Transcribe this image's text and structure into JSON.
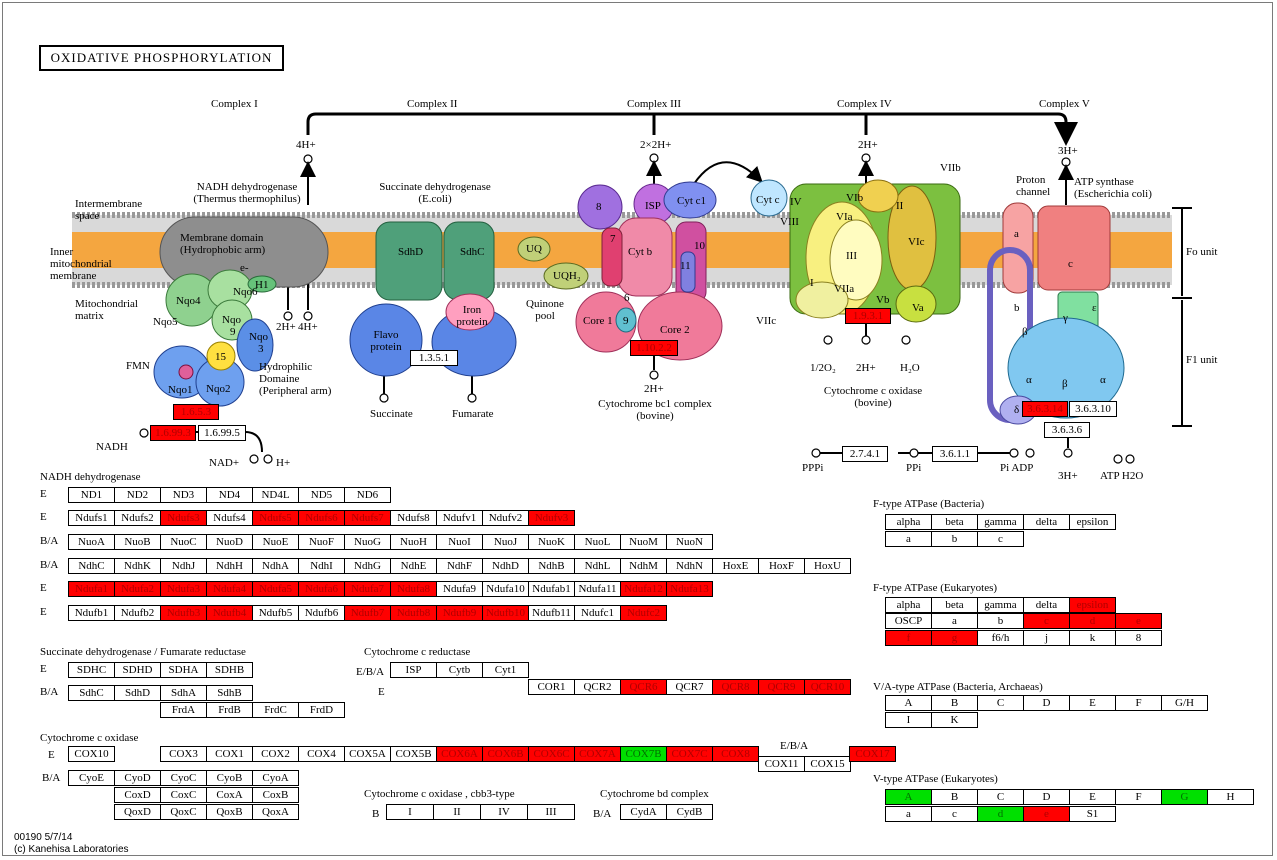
{
  "title": "OXIDATIVE PHOSPHORYLATION",
  "footer": {
    "line1": "00190 5/7/14",
    "line2": "(c) Kanehisa Laboratories"
  },
  "colors": {
    "red": "#ff0000",
    "green": "#00e000",
    "membrane": "#f4a640"
  },
  "diagram": {
    "complexes": [
      "Complex I",
      "Complex II",
      "Complex III",
      "Complex IV",
      "Complex V"
    ],
    "labels": {
      "intermembrane": "Intermembrane space",
      "inner_membrane": "Inner mitochondrial membrane",
      "matrix": "Mitochondrial matrix",
      "nadh_dh": "NADH dehydrogenase (Thermus thermophilus)",
      "membrane_domain": "Membrane domain (Hydrophobic arm)",
      "hydrophilic": "Hydrophilic Domaine (Peripheral arm)",
      "succ_dh": "Succinate dehydrogenase (E.coli)",
      "quinone_pool": "Quinone pool",
      "cyt_bc1": "Cytochrome bc1 complex (bovine)",
      "cyt_c_ox": "Cytochrome c oxidase (bovine)",
      "proton_channel": "Proton channel",
      "atp_synthase": "ATP synthase (Escherichia coli)",
      "fo_unit": "Fo unit",
      "f1_unit": "F1 unit"
    },
    "subunits_c1": [
      "Nqo6",
      "Nqo4",
      "Nqo5",
      "Nqo",
      "9",
      "Nqo",
      "3",
      "15",
      "Nqo1",
      "Nqo2",
      "FMN",
      "H1"
    ],
    "subunits_c2": [
      "SdhD",
      "SdhC",
      "Flavo protein",
      "Iron protein"
    ],
    "subunits_c3": [
      "8",
      "ISP",
      "Cyt c1",
      "7",
      "Cyt b",
      "10",
      "11",
      "6",
      "Core 1",
      "9",
      "Core 2"
    ],
    "subunits_c4": [
      "Cyt c",
      "IV",
      "VIII",
      "VIb",
      "VIa",
      "III",
      "II",
      "VIc",
      "I",
      "VIIa",
      "Vb",
      "Va",
      "VIIb",
      "VIIc"
    ],
    "subunits_c5": [
      "a",
      "c",
      "b",
      "γ",
      "ε",
      "β",
      "α",
      "β",
      "α",
      "δ"
    ],
    "metabolites": {
      "h4_a": "4H+",
      "h4_b": "4H+",
      "h2_a": "2H+",
      "h2x2": "2×2H+",
      "h2_c": "2H+",
      "h3": "3H+",
      "e": "e-",
      "uq": "UQ",
      "uqh2": "UQH₂",
      "succinate": "Succinate",
      "fumarate": "Fumarate",
      "nadh": "NADH",
      "nad": "NAD+",
      "h_nad": "H+",
      "h2_c3": "2H+",
      "o2": "1/2O₂",
      "h2_c4": "2H+",
      "h2o": "H₂O",
      "pppi": "PPPi",
      "ppi": "PPi",
      "pi_adp": "Pi ADP",
      "h3_c5": "3H+",
      "atp_h2o": "ATP H2O"
    },
    "ec_boxes": [
      {
        "label": "1.6.5.3",
        "state": "red"
      },
      {
        "label": "1.6.99.3",
        "state": "red"
      },
      {
        "label": "1.6.99.5",
        "state": "none"
      },
      {
        "label": "1.3.5.1",
        "state": "none"
      },
      {
        "label": "1.10.2.2",
        "state": "red"
      },
      {
        "label": "1.9.3.1",
        "state": "red"
      },
      {
        "label": "3.6.3.14",
        "state": "red"
      },
      {
        "label": "3.6.3.10",
        "state": "none"
      },
      {
        "label": "3.6.3.6",
        "state": "none"
      },
      {
        "label": "2.7.4.1",
        "state": "none"
      },
      {
        "label": "3.6.1.1",
        "state": "none"
      }
    ]
  },
  "gene_tables": {
    "nadh": {
      "title": "NADH dehydrogenase",
      "rows": [
        {
          "type": "E",
          "cells": [
            [
              "ND1",
              ""
            ],
            [
              "ND2",
              ""
            ],
            [
              "ND3",
              ""
            ],
            [
              "ND4",
              ""
            ],
            [
              "ND4L",
              ""
            ],
            [
              "ND5",
              ""
            ],
            [
              "ND6",
              ""
            ]
          ]
        },
        {
          "type": "E",
          "cells": [
            [
              "Ndufs1",
              ""
            ],
            [
              "Ndufs2",
              ""
            ],
            [
              "Ndufs3",
              "red"
            ],
            [
              "Ndufs4",
              ""
            ],
            [
              "Ndufs5",
              "red"
            ],
            [
              "Ndufs6",
              "red"
            ],
            [
              "Ndufs7",
              "red"
            ],
            [
              "Ndufs8",
              ""
            ],
            [
              "Ndufv1",
              ""
            ],
            [
              "Ndufv2",
              ""
            ],
            [
              "Ndufv3",
              "red"
            ]
          ]
        },
        {
          "type": "B/A",
          "cells": [
            [
              "NuoA",
              ""
            ],
            [
              "NuoB",
              ""
            ],
            [
              "NuoC",
              ""
            ],
            [
              "NuoD",
              ""
            ],
            [
              "NuoE",
              ""
            ],
            [
              "NuoF",
              ""
            ],
            [
              "NuoG",
              ""
            ],
            [
              "NuoH",
              ""
            ],
            [
              "NuoI",
              ""
            ],
            [
              "NuoJ",
              ""
            ],
            [
              "NuoK",
              ""
            ],
            [
              "NuoL",
              ""
            ],
            [
              "NuoM",
              ""
            ],
            [
              "NuoN",
              ""
            ]
          ]
        },
        {
          "type": "B/A",
          "cells": [
            [
              "NdhC",
              ""
            ],
            [
              "NdhK",
              ""
            ],
            [
              "NdhJ",
              ""
            ],
            [
              "NdhH",
              ""
            ],
            [
              "NdhA",
              ""
            ],
            [
              "NdhI",
              ""
            ],
            [
              "NdhG",
              ""
            ],
            [
              "NdhE",
              ""
            ],
            [
              "NdhF",
              ""
            ],
            [
              "NdhD",
              ""
            ],
            [
              "NdhB",
              ""
            ],
            [
              "NdhL",
              ""
            ],
            [
              "NdhM",
              ""
            ],
            [
              "NdhN",
              ""
            ],
            [
              "HoxE",
              ""
            ],
            [
              "HoxF",
              ""
            ],
            [
              "HoxU",
              ""
            ]
          ]
        },
        {
          "type": "E",
          "cells": [
            [
              "Ndufa1",
              "red"
            ],
            [
              "Ndufa2",
              "red"
            ],
            [
              "Ndufa3",
              "red"
            ],
            [
              "Ndufa4",
              "red"
            ],
            [
              "Ndufa5",
              "red"
            ],
            [
              "Ndufa6",
              "red"
            ],
            [
              "Ndufa7",
              "red"
            ],
            [
              "Ndufa8",
              "red"
            ],
            [
              "Ndufa9",
              ""
            ],
            [
              "Ndufa10",
              ""
            ],
            [
              "Ndufab1",
              ""
            ],
            [
              "Ndufa11",
              ""
            ],
            [
              "Ndufa12",
              "red"
            ],
            [
              "Ndufa13",
              "red"
            ]
          ]
        },
        {
          "type": "E",
          "cells": [
            [
              "Ndufb1",
              ""
            ],
            [
              "Ndufb2",
              ""
            ],
            [
              "Ndufb3",
              "red"
            ],
            [
              "Ndufb4",
              "red"
            ],
            [
              "Ndufb5",
              ""
            ],
            [
              "Ndufb6",
              ""
            ],
            [
              "Ndufb7",
              "red"
            ],
            [
              "Ndufb8",
              "red"
            ],
            [
              "Ndufb9",
              "red"
            ],
            [
              "Ndufb10",
              "red"
            ],
            [
              "Ndufb11",
              ""
            ],
            [
              "Ndufc1",
              ""
            ],
            [
              "Ndufc2",
              "red"
            ]
          ]
        }
      ]
    },
    "succinate": {
      "title": "Succinate dehydrogenase / Fumarate reductase",
      "rows": [
        {
          "type": "E",
          "cells": [
            [
              "SDHC",
              ""
            ],
            [
              "SDHD",
              ""
            ],
            [
              "SDHA",
              ""
            ],
            [
              "SDHB",
              ""
            ]
          ]
        },
        {
          "type": "B/A",
          "cells": [
            [
              "SdhC",
              ""
            ],
            [
              "SdhD",
              ""
            ],
            [
              "SdhA",
              ""
            ],
            [
              "SdhB",
              ""
            ]
          ]
        },
        {
          "type": "",
          "cells": [
            [
              "FrdA",
              ""
            ],
            [
              "FrdB",
              ""
            ],
            [
              "FrdC",
              ""
            ],
            [
              "FrdD",
              ""
            ]
          ]
        }
      ]
    },
    "cyt_c_reductase": {
      "title": "Cytochrome c reductase",
      "rows": [
        {
          "type": "E/B/A",
          "cells": [
            [
              "ISP",
              ""
            ],
            [
              "Cytb",
              ""
            ],
            [
              "Cyt1",
              ""
            ]
          ]
        },
        {
          "type": "E",
          "cells": [
            [
              "COR1",
              ""
            ],
            [
              "QCR2",
              ""
            ],
            [
              "QCR6",
              "red"
            ],
            [
              "QCR7",
              ""
            ],
            [
              "QCR8",
              "red"
            ],
            [
              "QCR9",
              "red"
            ],
            [
              "QCR10",
              "red"
            ]
          ]
        }
      ]
    },
    "cyt_c_oxidase": {
      "title": "Cytochrome c oxidase",
      "rows": [
        {
          "type": "E",
          "cells": [
            [
              "COX10",
              ""
            ],
            [
              "COX3",
              ""
            ],
            [
              "COX1",
              ""
            ],
            [
              "COX2",
              ""
            ],
            [
              "COX4",
              ""
            ],
            [
              "COX5A",
              ""
            ],
            [
              "COX5B",
              ""
            ],
            [
              "COX6A",
              "red"
            ],
            [
              "COX6B",
              "red"
            ],
            [
              "COX6C",
              "red"
            ],
            [
              "COX7A",
              "red"
            ],
            [
              "COX7B",
              "green"
            ],
            [
              "COX7C",
              "red"
            ],
            [
              "COX8",
              "red"
            ],
            [
              "COX11",
              ""
            ],
            [
              "COX15",
              ""
            ],
            [
              "COX17",
              "red"
            ]
          ]
        },
        {
          "type": "B/A",
          "cells": [
            [
              "CyoE",
              ""
            ],
            [
              "CyoD",
              ""
            ],
            [
              "CyoC",
              ""
            ],
            [
              "CyoB",
              ""
            ],
            [
              "CyoA",
              ""
            ],
            [
              "CoxD",
              ""
            ],
            [
              "CoxC",
              ""
            ],
            [
              "CoxA",
              ""
            ],
            [
              "CoxB",
              ""
            ],
            [
              "QoxD",
              ""
            ],
            [
              "QoxC",
              ""
            ],
            [
              "QoxB",
              ""
            ],
            [
              "QoxA",
              ""
            ]
          ]
        }
      ],
      "ebba_label": "E/B/A"
    },
    "cbb3": {
      "title": "Cytochrome c oxidase , cbb3-type",
      "type": "B",
      "cells": [
        [
          "I",
          ""
        ],
        [
          "II",
          ""
        ],
        [
          "IV",
          ""
        ],
        [
          "III",
          ""
        ]
      ]
    },
    "cytbd": {
      "title": "Cytochrome bd complex",
      "type": "B/A",
      "cells": [
        [
          "CydA",
          ""
        ],
        [
          "CydB",
          ""
        ]
      ]
    },
    "ftype_bact": {
      "title": "F-type ATPase (Bacteria)",
      "rows": [
        [
          [
            "alpha",
            ""
          ],
          [
            "beta",
            ""
          ],
          [
            "gamma",
            ""
          ],
          [
            "delta",
            ""
          ],
          [
            "epsilon",
            ""
          ]
        ],
        [
          [
            "a",
            ""
          ],
          [
            "b",
            ""
          ],
          [
            "c",
            ""
          ]
        ]
      ]
    },
    "ftype_euk": {
      "title": "F-type ATPase (Eukaryotes)",
      "rows": [
        [
          [
            "alpha",
            ""
          ],
          [
            "beta",
            ""
          ],
          [
            "gamma",
            ""
          ],
          [
            "delta",
            ""
          ],
          [
            "epsilon",
            "red"
          ]
        ],
        [
          [
            "OSCP",
            ""
          ],
          [
            "a",
            ""
          ],
          [
            "b",
            ""
          ],
          [
            "c",
            "red"
          ],
          [
            "d",
            "red"
          ],
          [
            "e",
            "red"
          ]
        ],
        [
          [
            "f",
            "red"
          ],
          [
            "g",
            "red"
          ],
          [
            "f6/h",
            ""
          ],
          [
            "j",
            ""
          ],
          [
            "k",
            ""
          ],
          [
            "8",
            ""
          ]
        ]
      ]
    },
    "va_type": {
      "title": "V/A-type ATPase (Bacteria, Archaeas)",
      "rows": [
        [
          [
            "A",
            ""
          ],
          [
            "B",
            ""
          ],
          [
            "C",
            ""
          ],
          [
            "D",
            ""
          ],
          [
            "E",
            ""
          ],
          [
            "F",
            ""
          ],
          [
            "G/H",
            ""
          ]
        ],
        [
          [
            "I",
            ""
          ],
          [
            "K",
            ""
          ]
        ]
      ]
    },
    "v_type": {
      "title": "V-type ATPase (Eukaryotes)",
      "rows": [
        [
          [
            "A",
            "green"
          ],
          [
            "B",
            ""
          ],
          [
            "C",
            ""
          ],
          [
            "D",
            ""
          ],
          [
            "E",
            ""
          ],
          [
            "F",
            ""
          ],
          [
            "G",
            "green"
          ],
          [
            "H",
            ""
          ]
        ],
        [
          [
            "a",
            ""
          ],
          [
            "c",
            ""
          ],
          [
            "d",
            "green"
          ],
          [
            "e",
            "red"
          ],
          [
            "S1",
            ""
          ]
        ]
      ]
    }
  }
}
